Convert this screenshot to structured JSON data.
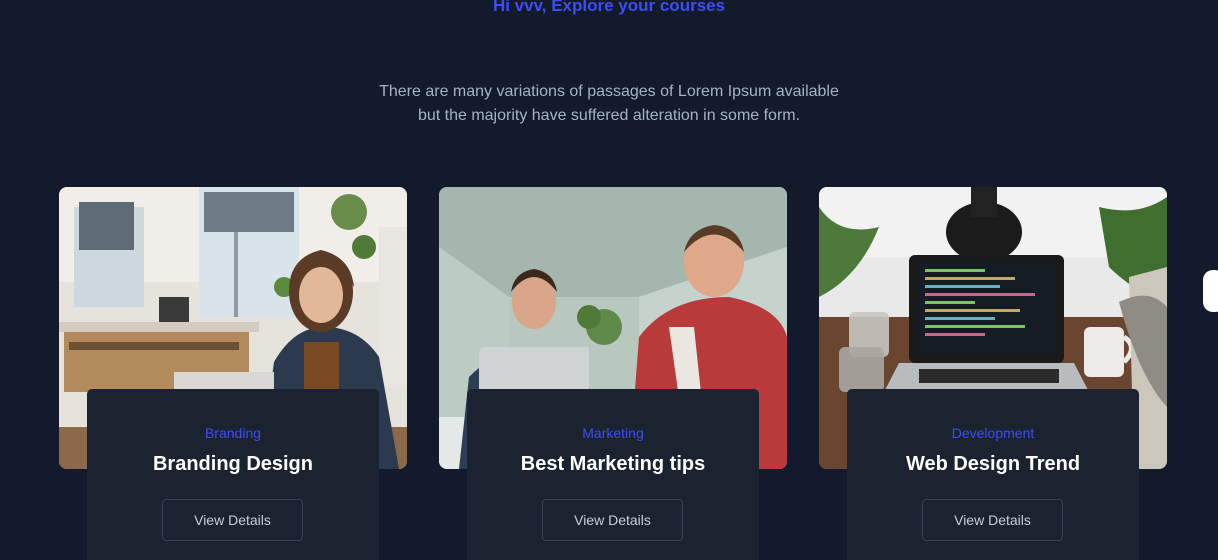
{
  "header": {
    "greeting": "Hi vvv, Explore your courses",
    "intro_lines": [
      "There are many variations of passages of Lorem Ipsum available",
      "but the majority have suffered alteration in some form."
    ]
  },
  "courses": [
    {
      "category": "Branding",
      "title": "Branding Design",
      "button": "View Details"
    },
    {
      "category": "Marketing",
      "title": "Best Marketing tips",
      "button": "View Details"
    },
    {
      "category": "Development",
      "title": "Web Design Trend",
      "button": "View Details"
    }
  ],
  "colors": {
    "background": "#121a2b",
    "card": "#1b2331",
    "accent": "#3d4ef5",
    "text_muted": "#a9b2c2"
  },
  "icons": {
    "slider_next": "slider-next-icon"
  }
}
